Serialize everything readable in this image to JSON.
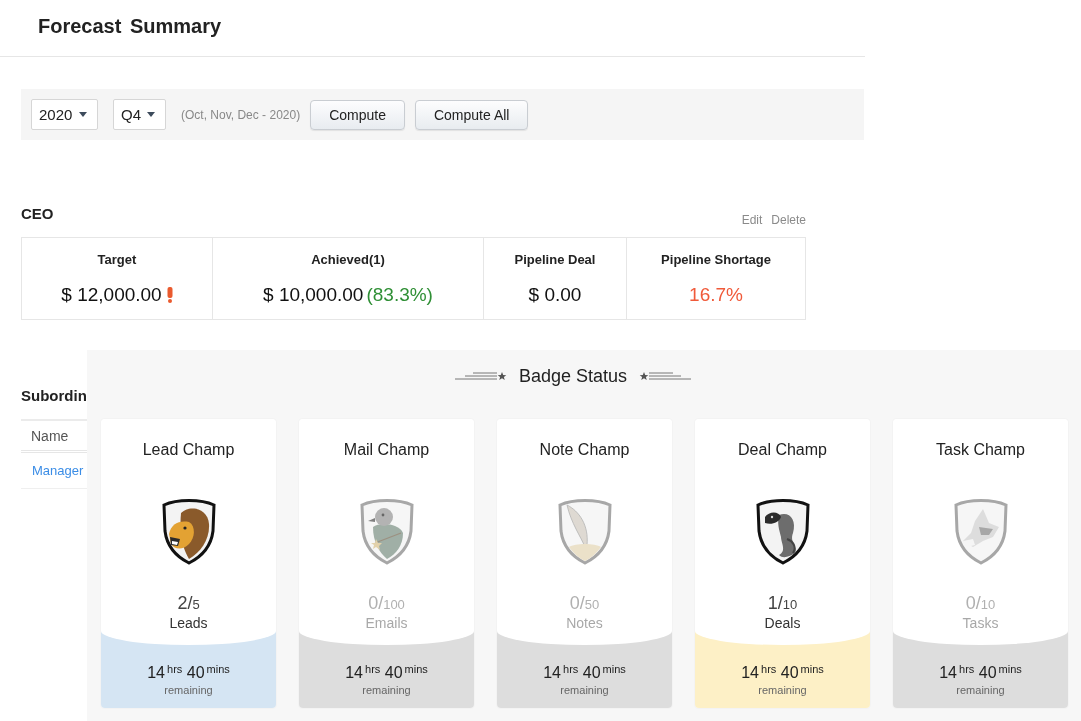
{
  "header": {
    "title": "Forecast Summary"
  },
  "toolbar": {
    "year": {
      "value": "2020"
    },
    "quarter": {
      "value": "Q4"
    },
    "range": "(Oct, Nov, Dec - 2020)",
    "buttons": [
      "Compute",
      "Compute All"
    ]
  },
  "ceo": {
    "title": "CEO",
    "actions": [
      "Edit",
      "Delete"
    ],
    "stats": [
      {
        "label": "Target",
        "value": "$ 12,000.00",
        "color": "#111111",
        "warning": true
      },
      {
        "label": "Achieved(1)",
        "value": "$ 10,000.00",
        "color": "#111111",
        "warning": false,
        "note": {
          "text": "(83.3%)",
          "color": "#2f8f35"
        }
      },
      {
        "label": "Pipeline Deal",
        "value": "$ 0.00",
        "color": "#111111",
        "warning": false
      },
      {
        "label": "Pipeline Shortage",
        "value": "16.7%",
        "color": "#f05a3a",
        "warning": false
      }
    ]
  },
  "subordinates": {
    "title": "Subordin",
    "columns": [
      "Name"
    ],
    "rows": [
      {
        "name": "Manager"
      }
    ]
  },
  "badge_status": {
    "title": "Badge Status",
    "badges": [
      {
        "title": "Lead Champ",
        "count": "2/",
        "total": "5",
        "unit": "Leads",
        "time": "14$^{hrs}$ 40$^{mins}$",
        "remaining": "remaining",
        "started": true,
        "color": "#d5e5f3"
      },
      {
        "title": "Mail Champ",
        "count": "0/",
        "total": "100",
        "unit": "Emails",
        "time": "14$^{hrs}$ 40$^{mins}$",
        "remaining": "remaining",
        "started": false,
        "color": "#dddddd"
      },
      {
        "title": "Note Champ",
        "count": "0/",
        "total": "50",
        "unit": "Notes",
        "time": "14$^{hrs}$ 40$^{mins}$",
        "remaining": "remaining",
        "started": false,
        "color": "#dddddd"
      },
      {
        "title": "Deal Champ",
        "count": "1/",
        "total": "10",
        "unit": "Deals",
        "time": "14$^{hrs}$ 40$^{mins}$",
        "remaining": "remaining",
        "started": true,
        "color": "#fdf0c6"
      },
      {
        "title": "Task Champ",
        "count": "0/",
        "total": "10",
        "unit": "Tasks",
        "time": "14$^{hrs}$ 40$^{mins}$",
        "remaining": "remaining",
        "started": false,
        "color": "#dddddd"
      }
    ]
  }
}
